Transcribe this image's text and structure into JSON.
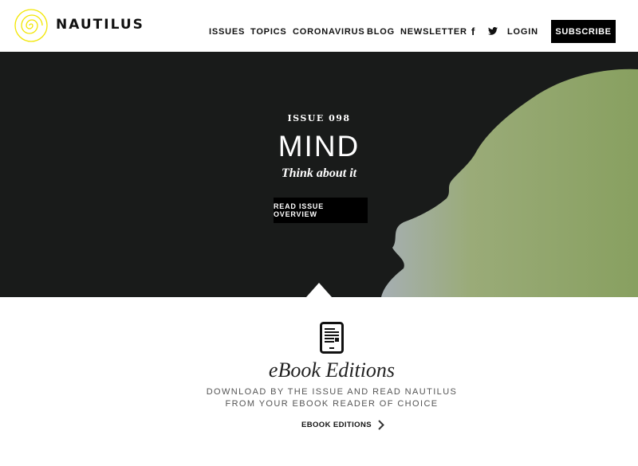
{
  "brand": {
    "name": "NAUTILUS",
    "logo_icon": "spiral-logo-icon",
    "logo_color": "#f2e600"
  },
  "nav": {
    "items": [
      "ISSUES",
      "TOPICS",
      "CORONAVIRUS",
      "BLOG",
      "NEWSLETTER"
    ],
    "facebook": "f",
    "twitter_icon": "twitter-icon",
    "login": "LOGIN",
    "subscribe": "SUBSCRIBE"
  },
  "hero": {
    "issue_label": "ISSUE 098",
    "title": "MIND",
    "subtitle": "Think about it",
    "cta": "READ ISSUE OVERVIEW",
    "background": "#191b1a",
    "art_color": "#9aab78"
  },
  "ebook": {
    "icon": "ebook-reader-icon",
    "title": "eBook Editions",
    "description": "DOWNLOAD BY THE ISSUE AND READ NAUTILUS FROM YOUR EBOOK READER OF CHOICE",
    "link": "EBOOK EDITIONS",
    "link_icon": "chevron-right-icon"
  }
}
